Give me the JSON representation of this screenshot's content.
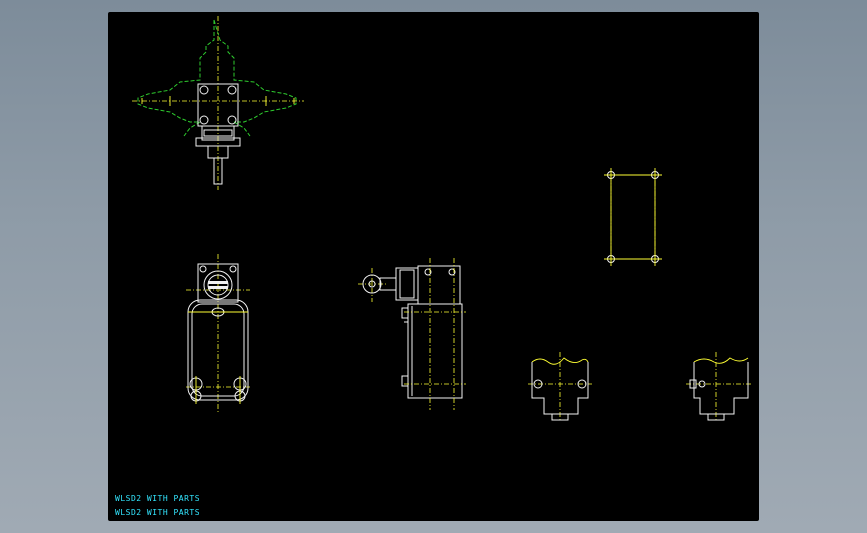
{
  "labels": {
    "line1": "WLSD2 WITH PARTS",
    "line2": "WLSD2 WITH PARTS"
  },
  "colors": {
    "background": "#000000",
    "geometry": "#f2f2f2",
    "centerline": "#ffff33",
    "phantom": "#2ecc2e",
    "annotation": "#33e6ff"
  }
}
